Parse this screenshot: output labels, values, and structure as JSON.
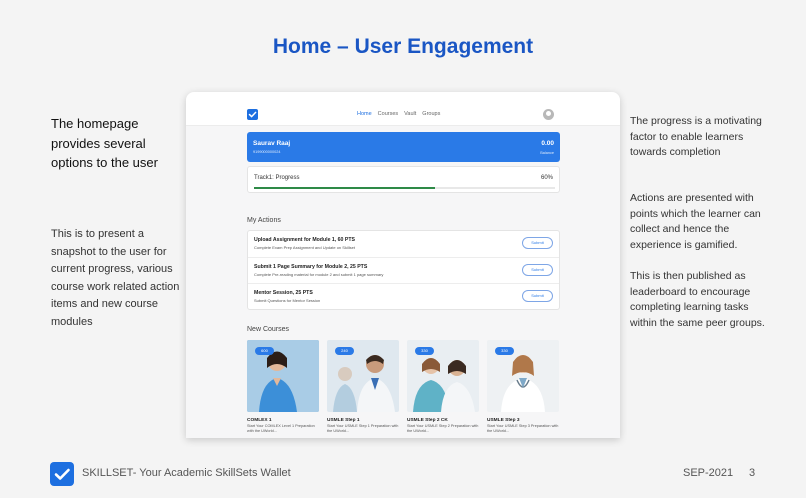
{
  "title": "Home – User Engagement",
  "left": {
    "heading": "The homepage provides several options to the user",
    "body": "This is to present a snapshot to the user for current progress, various course work related action items and new course modules"
  },
  "right": [
    "The progress is a motivating factor to enable learners towards completion",
    "Actions are presented with points which the learner can collect and hence the experience is gamified.",
    "This is then published as leaderboard to encourage completing learning tasks within the same peer groups."
  ],
  "app": {
    "nav": [
      "Home",
      "Courses",
      "Vault",
      "Groups"
    ],
    "user": {
      "name": "Saurav Raaj",
      "id": "9199000000024",
      "balance": "0.00",
      "balance_label": "Balance"
    },
    "progress": {
      "label": "Track1: Progress",
      "value_text": "60%",
      "fraction": 0.6
    },
    "actions_title": "My Actions",
    "actions": [
      {
        "title": "Upload Assignment for Module 1, 60 PTS",
        "desc": "Complete Exam Prep Assignment and Update on Skillset",
        "button": "Submit"
      },
      {
        "title": "Submit 1 Page Summary for Module 2, 25 PTS",
        "desc": "Complete Pre-reading material for module 2 and submit 1 page summary",
        "button": "Submit"
      },
      {
        "title": "Mentor Session, 25 PTS",
        "desc": "Submit Questions for Mentor Session",
        "button": "Submit"
      }
    ],
    "courses_title": "New Courses",
    "courses": [
      {
        "badge": "600",
        "title": "COMLEX 1",
        "desc": "Start Your COMLEX Level 1 Preparation with the UWorld..."
      },
      {
        "badge": "240",
        "title": "USMLE Step 1",
        "desc": "Start Your USMLE Step 1 Preparation with the UWorld..."
      },
      {
        "badge": "330",
        "title": "USMLE Step 2 CK",
        "desc": "Start Your USMLE Step 2 Preparation with the UWorld..."
      },
      {
        "badge": "330",
        "title": "USMLE Step 3",
        "desc": "Start Your USMLE Step 3 Preparation with the UWorld..."
      }
    ]
  },
  "footer": {
    "brand": "SKILLSET- Your Academic SkillSets Wallet",
    "date": "SEP-2021",
    "page": "3"
  },
  "colors": {
    "title": "#1a56c4",
    "accent": "#2a7ae7",
    "progress": "#2e8a47"
  }
}
